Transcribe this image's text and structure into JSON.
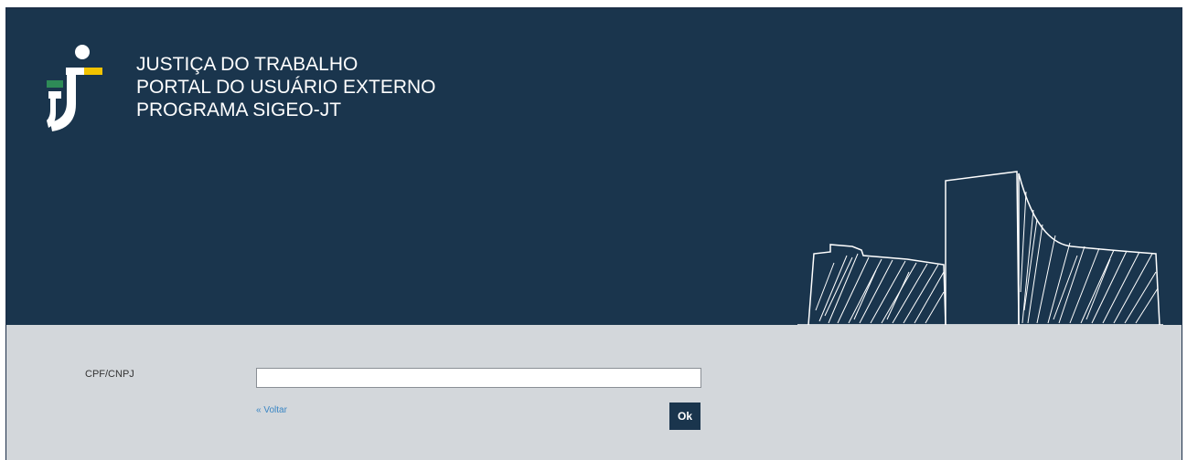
{
  "header": {
    "title_lines": [
      "JUSTIÇA DO TRABALHO",
      "PORTAL DO USUÁRIO EXTERNO",
      "PROGRAMA SIGEO-JT"
    ],
    "logo_icon": "jt-logo-icon",
    "illustration_icon": "tst-building-sketch-icon",
    "colors": {
      "background": "#1a354d",
      "logo_green": "#2e8b57",
      "logo_yellow": "#f2c300",
      "text": "#ffffff"
    }
  },
  "form": {
    "cpf_label": "CPF/CNPJ",
    "cpf_value": "",
    "back_link": "« Voltar",
    "ok_button": "Ok",
    "colors": {
      "background": "#d3d7db",
      "link": "#3a86c4",
      "button": "#1a354d"
    }
  }
}
